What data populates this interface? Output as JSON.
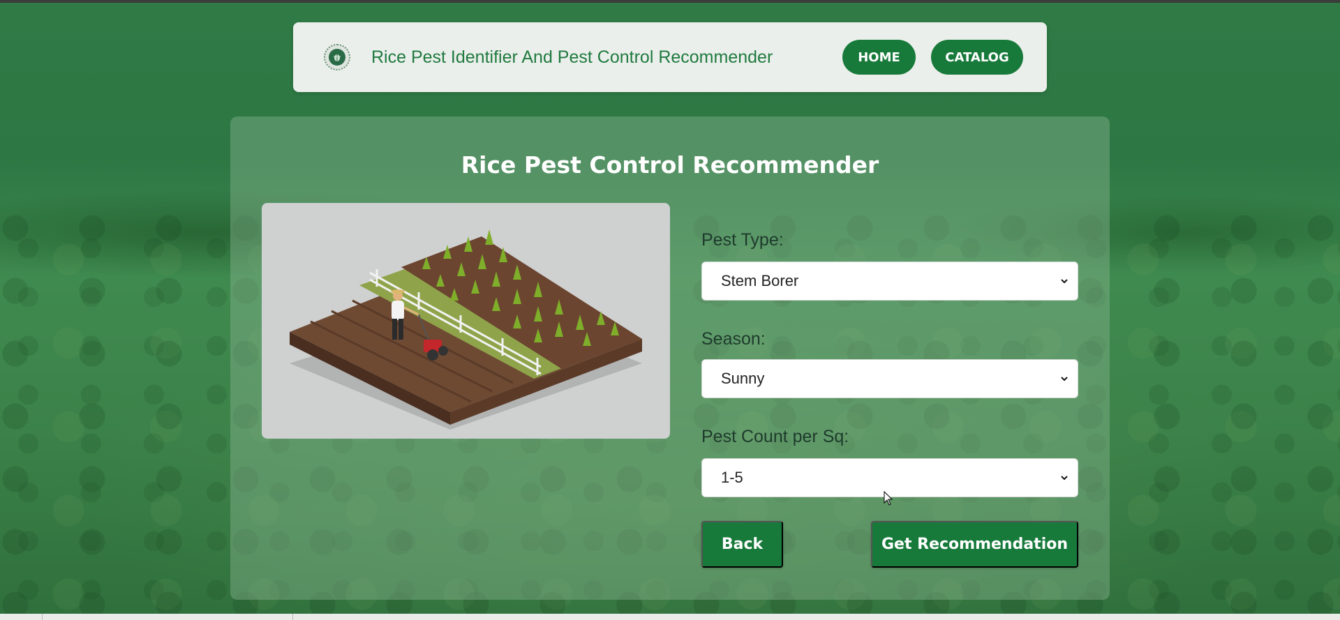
{
  "nav": {
    "title": "Rice Pest Identifier And Pest Control Recommender",
    "home_label": "HOME",
    "catalog_label": "CATALOG",
    "logo_icon": "leaf-logo-icon"
  },
  "card": {
    "title": "Rice Pest Control Recommender",
    "illustration_icon": "farmer-tilling-field-illustration"
  },
  "form": {
    "pest_type_label": "Pest Type:",
    "pest_type_value": "Stem Borer",
    "season_label": "Season:",
    "season_value": "Sunny",
    "pest_count_label": "Pest Count per Sq:",
    "pest_count_value": "1-5",
    "back_label": "Back",
    "get_label": "Get Recommendation"
  },
  "colors": {
    "accent": "#177a3b",
    "title_green": "#1f7a3f",
    "navbar_bg": "#ebefeb"
  }
}
